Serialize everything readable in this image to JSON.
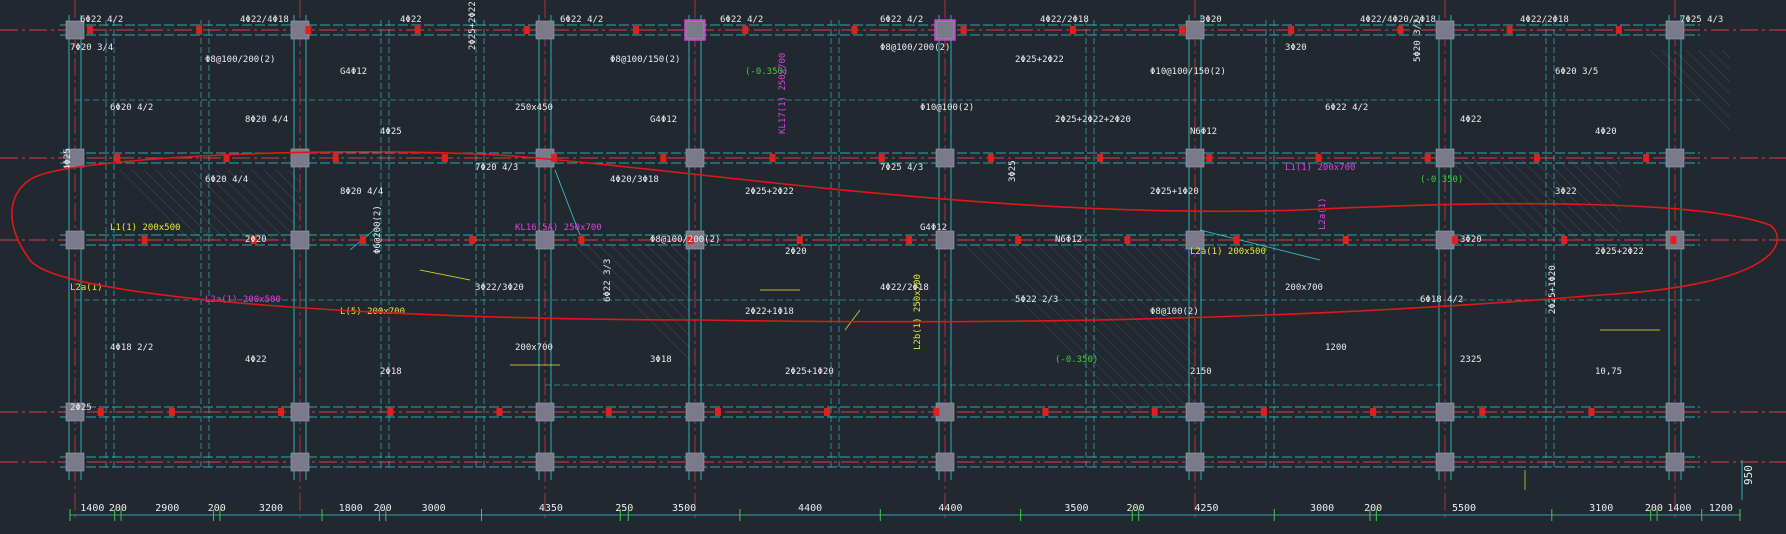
{
  "colors": {
    "background": "#212830",
    "gridline": "#d84040",
    "beam": "#35d0d0",
    "column": "#7a7a8a",
    "text_white": "#ececec",
    "text_yellow": "#e8e83a",
    "text_magenta": "#e040e0",
    "text_green": "#3ad03a",
    "markup": "#e01818"
  },
  "top_row_labels": [
    "6Φ22 4/2",
    "4Φ22/4Φ18",
    "4Φ22",
    "6Φ22 4/2",
    "6Φ22 4/2",
    "6Φ22 4/2",
    "4Φ22/2Φ18",
    "3Φ20",
    "4Φ22/4Φ20/2Φ18",
    "4Φ22/2Φ18",
    "7Φ25 4/3"
  ],
  "beam_notes": [
    "7Φ20 3/4",
    "Φ8@100/200(2)",
    "G4Φ12",
    "2Φ25+2Φ22",
    "Φ8@100/150(2)",
    "(-0.350)",
    "Φ8@100/200(2)",
    "2Φ25+2Φ22",
    "Φ10@100/150(2)",
    "3Φ20",
    "5Φ20 3/2",
    "6Φ20 3/5",
    "6Φ20 4/2",
    "8Φ20 4/4",
    "4Φ25",
    "250x450",
    "G4Φ12",
    "KL17(1) 250x700",
    "Φ10@100(2)",
    "2Φ25+2Φ22+2Φ20",
    "N6Φ12",
    "6Φ22 4/2",
    "4Φ22",
    "4Φ20",
    "4Φ25",
    "6Φ20 4/4",
    "8Φ20 4/4",
    "7Φ20 4/3",
    "4Φ20/3Φ18",
    "2Φ25+2Φ22",
    "7Φ25 4/3",
    "3Φ25",
    "2Φ25+1Φ20",
    "L1(1) 200x700",
    "(-0.350)",
    "3Φ22",
    "L1(1) 200x500",
    "2Φ20",
    "Φ6@200(2)",
    "KL16(5A) 250x700",
    "Φ8@100/200(2)",
    "2Φ20",
    "G4Φ12",
    "N6Φ12",
    "L2a(1) 200x500",
    "L2a(1)",
    "3Φ20",
    "2Φ25+2Φ22",
    "L2a(1)",
    "L2a(1) 200x500",
    "L(5) 200x700",
    "3Φ22/3Φ20",
    "6Φ22 3/3",
    "2Φ22+1Φ18",
    "4Φ22/2Φ18",
    "5Φ22 2/3",
    "Φ8@100(2)",
    "200x700",
    "6Φ18 4/2",
    "2Φ25+1Φ20",
    "4Φ18 2/2",
    "4Φ22",
    "2Φ18",
    "200x700",
    "3Φ18",
    "2Φ25+1Φ20",
    "L2b(1) 250x700",
    "(-0.350)",
    "2150",
    "1200",
    "2325",
    "10,75",
    "2Φ25"
  ],
  "dimensions": [
    "1400",
    "200",
    "2900",
    "200",
    "3200",
    "1800",
    "200",
    "3000",
    "4350",
    "250",
    "3500",
    "4400",
    "4400",
    "3500",
    "200",
    "4250",
    "3000",
    "200",
    "5500",
    "3100",
    "200",
    "1400",
    "1200"
  ],
  "side_dim": "950"
}
